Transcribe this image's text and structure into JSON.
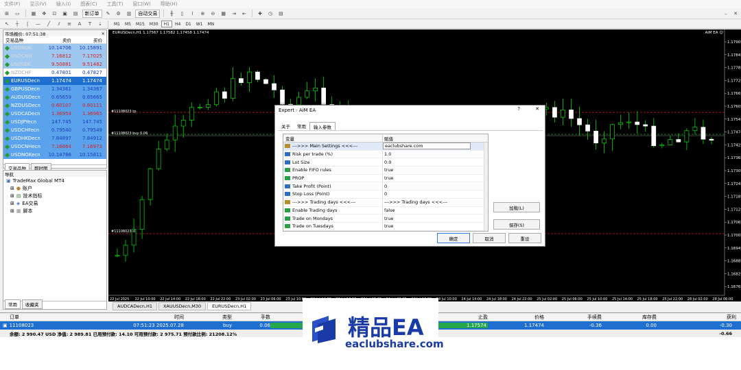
{
  "menu": [
    "文件(F)",
    "显示(V)",
    "插入(I)",
    "图表(C)",
    "工具(T)",
    "窗口(W)",
    "帮助(H)"
  ],
  "toolbar": {
    "new_order": "新订单",
    "auto_trade": "自动交易"
  },
  "timeframes": [
    "M1",
    "M5",
    "M15",
    "M30",
    "H1",
    "H4",
    "D1",
    "W1",
    "MN"
  ],
  "market_watch": {
    "title": "市场报价: 07:51:38",
    "col_symbol": "交易品种",
    "col_bid": "卖价",
    "col_ask": "买价",
    "rows": [
      {
        "symbol": "USDNOK",
        "bid": "10.14706",
        "ask": "10.15891",
        "style": "selx"
      },
      {
        "symbol": "USDCNH",
        "bid": "7.16812",
        "ask": "7.17025",
        "style": "selx"
      },
      {
        "symbol": "USDSEK",
        "bid": "9.50881",
        "ask": "9.51482",
        "style": "selx"
      },
      {
        "symbol": "NZDCHF",
        "bid": "0.47801",
        "ask": "0.47827",
        "style": ""
      },
      {
        "symbol": "EURUSDecn",
        "bid": "1.17474",
        "ask": "1.17474",
        "style": "sel"
      },
      {
        "symbol": "GBPUSDecn",
        "bid": "1.34361",
        "ask": "1.34367",
        "style": "selx"
      },
      {
        "symbol": "AUDUSDecn",
        "bid": "0.65659",
        "ask": "0.65665",
        "style": "selx"
      },
      {
        "symbol": "NZDUSDecn",
        "bid": "0.60107",
        "ask": "0.60111",
        "style": "selx"
      },
      {
        "symbol": "USDCADecn",
        "bid": "1.36954",
        "ask": "1.36965",
        "style": "selx"
      },
      {
        "symbol": "USDJPYecn",
        "bid": "147.745",
        "ask": "147.745",
        "style": "selx"
      },
      {
        "symbol": "USDCHFecn",
        "bid": "0.79540",
        "ask": "0.79549",
        "style": "selx"
      },
      {
        "symbol": "USDHKDecn",
        "bid": "7.84897",
        "ask": "7.84912",
        "style": "selx"
      },
      {
        "symbol": "USDCNHecn",
        "bid": "7.16864",
        "ask": "7.16973",
        "style": "selx"
      },
      {
        "symbol": "USDNOKecn",
        "bid": "10.14786",
        "ask": "10.15811",
        "style": "selx"
      }
    ],
    "tab_symbols": "交易品种",
    "tab_ticks": "即时图"
  },
  "navigator": {
    "title": "导航",
    "items": [
      "TradeMax Global MT4",
      "账户",
      "技术指标",
      "EA交易",
      "脚本"
    ],
    "tab_common": "常用",
    "tab_fav": "收藏夹"
  },
  "chart": {
    "title": "EURUSDecn,H1  1.17567 1.17582 1.17458 1.17474",
    "ea_label": "AiM EA ☺",
    "line_tp": "#11108023 tp",
    "line_buy": "#11108023 buy 0.06",
    "line_sl": "#11108023 sl",
    "price_labels": [
      "1.17905",
      "1.17845",
      "1.17785",
      "1.17725",
      "1.17665",
      "1.17605",
      "1.17545",
      "1.17474",
      "1.17425",
      "1.17365",
      "1.17305",
      "1.17245",
      "1.17185",
      "1.17125",
      "1.17065",
      "1.17005",
      "1.16945",
      "1.16885",
      "1.16825",
      "1.16765"
    ],
    "time_labels": [
      "22 Jul 2025",
      "22 Jul 10:00",
      "22 Jul 14:00",
      "22 Jul 18:00",
      "22 Jul 22:00",
      "23 Jul 02:00",
      "23 Jul 06:00",
      "23 Jul 10:00",
      "23 Jul 14:00",
      "23 Jul 18:00",
      "23 Jul 22:00",
      "24 Jul 02:00",
      "24 Jul 06:00",
      "24 Jul 10:00",
      "24 Jul 14:00",
      "24 Jul 18:00",
      "24 Jul 22:00",
      "25 Jul 02:00",
      "25 Jul 06:00",
      "25 Jul 10:00",
      "25 Jul 14:00",
      "25 Jul 18:00",
      "25 Jul 22:00",
      "28 Jul 02:00",
      "28 Jul 06:00"
    ],
    "tabs": [
      "AUDCADecn,H1",
      "XAUUSDecn,M30",
      "EURUSDecn,H1"
    ]
  },
  "terminal": {
    "headers": [
      "订单",
      "时间",
      "类型",
      "手数",
      "止盈",
      "价格",
      "手续费",
      "库存费",
      "获利"
    ],
    "row": {
      "order": "11108023",
      "time": "2025.07.28 07:51:23",
      "type": "buy",
      "lots": "0.06",
      "tp": "1.17574",
      "price": "1.17474",
      "commission": "-0.36",
      "swap": "0.00",
      "profit": "-0.30"
    },
    "balance": "余额: 2 990.47 USD  净值: 2 989.81  已用预付款: 14.10  可用预付款: 2 975.71  预付款比例: 21208.12%",
    "balance_profit": "-0.66"
  },
  "dialog": {
    "title": "Expert - AiM EA",
    "help": "?",
    "close": "✕",
    "tabs": [
      "关于",
      "常用",
      "输入参数"
    ],
    "col_var": "变量",
    "col_val": "赋值",
    "params": [
      {
        "icon": "ab",
        "name": "--->>>  Main Settings  <<<---",
        "value": "eaclubshare.com"
      },
      {
        "icon": "v",
        "name": "Risk per trade (%)",
        "value": "1.0"
      },
      {
        "icon": "v",
        "name": "Lot Size",
        "value": "0.0"
      },
      {
        "icon": "g",
        "name": "Enable FIFO rules",
        "value": "true"
      },
      {
        "icon": "g",
        "name": "PROP",
        "value": "true"
      },
      {
        "icon": "n",
        "name": "Take Profit (Point)",
        "value": "0"
      },
      {
        "icon": "n",
        "name": "Stop Loss (Point)",
        "value": "0"
      },
      {
        "icon": "ab",
        "name": "--->>>  Trading days  <<<---",
        "value": "--->>>  Trading days  <<<---"
      },
      {
        "icon": "g",
        "name": "Enable Trading days",
        "value": "false"
      },
      {
        "icon": "g",
        "name": "Trade on Mondays",
        "value": "true"
      },
      {
        "icon": "g",
        "name": "Trade on Tuesdays",
        "value": "true"
      }
    ],
    "load": "加载(L)",
    "save": "保存(S)",
    "ok": "确定",
    "cancel": "取消",
    "reset": "重设"
  },
  "watermark": {
    "cn": "精品EA",
    "url": "eaclubshare.com"
  }
}
